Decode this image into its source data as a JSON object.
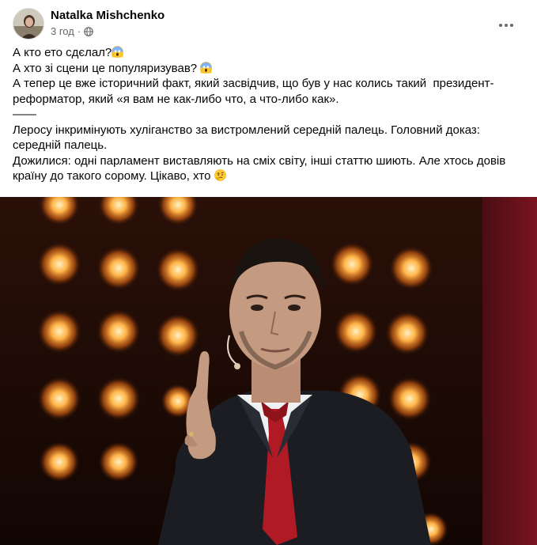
{
  "post": {
    "author": "Natalka Mishchenko",
    "time": "3 год",
    "separator": "·",
    "privacy_icon": "globe-icon",
    "more_icon": "more-options-icon",
    "lines": [
      "А кто ето сдєлал?",
      "А хто зі сцени це популяризував? ",
      "А тепер це вже історичний факт, який засвідчив, що був у нас колись такий  президент-реформатор, який «я вам не как-либо что, а что-либо как».",
      "——",
      "Леросу інкримінують хуліганство за вистромлений середній палець. Головний доказ: середній палець.",
      "Дожилися: одні парламент виставляють на сміх світу, інші статтю шиють. Але хтось довів країну до такого сорому. Цікаво, хто "
    ],
    "emojis": [
      "screaming-face-emoji",
      "screaming-face-emoji",
      "thinking-face-emoji"
    ]
  },
  "colors": {
    "text": "#050505",
    "secondary": "#65676b",
    "photo_bg": "#1a0b05",
    "stage_light": "#ffb347",
    "tie": "#b01a24"
  }
}
